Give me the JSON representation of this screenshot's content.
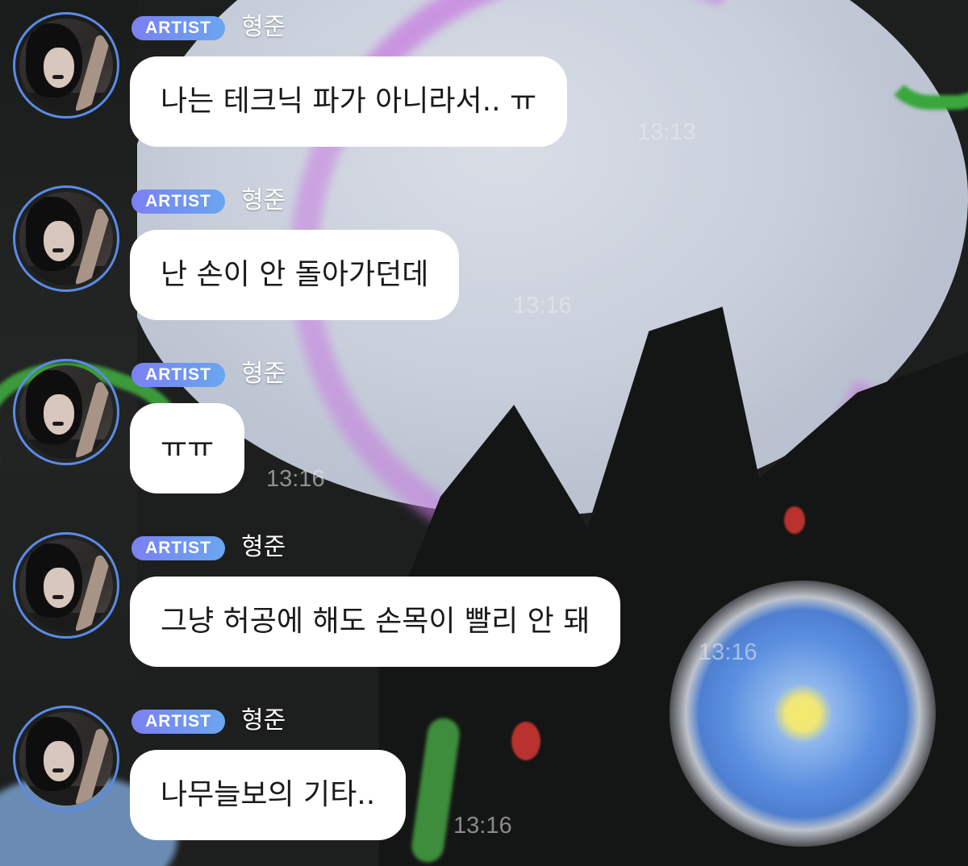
{
  "chat": {
    "messages": [
      {
        "badge": "ARTIST",
        "sender": "형준",
        "text": "나는 테크닉 파가 아니라서.. ㅠ",
        "time": "13:13"
      },
      {
        "badge": "ARTIST",
        "sender": "형준",
        "text": "난 손이 안 돌아가던데",
        "time": "13:16"
      },
      {
        "badge": "ARTIST",
        "sender": "형준",
        "text": "ㅠㅠ",
        "time": "13:16"
      },
      {
        "badge": "ARTIST",
        "sender": "형준",
        "text": "그냥 허공에 해도 손목이 빨리 안 돼",
        "time": "13:16"
      },
      {
        "badge": "ARTIST",
        "sender": "형준",
        "text": "나무늘보의 기타..",
        "time": "13:16"
      }
    ]
  },
  "colors": {
    "badge_gradient_start": "#7b80f2",
    "badge_gradient_end": "#6aa6f0",
    "avatar_ring": "#5b8be8",
    "bubble": "#ffffff"
  }
}
